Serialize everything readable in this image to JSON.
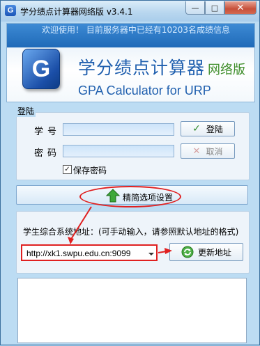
{
  "window": {
    "title": "学分绩点计算器网络版 v3.4.1",
    "app_icon_letter": "G",
    "minimize_symbol": "—",
    "maximize_symbol": "□",
    "close_symbol": "✕"
  },
  "banner": {
    "marquee": "欢迎使用！ 目前服务器中已经有10203名成绩信息",
    "logo_letter": "G",
    "title_cn": "学分绩点计算器",
    "title_suffix": "网络版",
    "title_en": "GPA Calculator for URP"
  },
  "login": {
    "group_label": "登陆",
    "student_id_label": "学号",
    "password_label": "密码",
    "student_id_value": "",
    "password_value": "",
    "login_button": "登陆",
    "cancel_button": "取消",
    "remember_label": "保存密码",
    "remember_checked": true,
    "check_mark": "✓"
  },
  "settings": {
    "toggle_label": "精简选项设置"
  },
  "address": {
    "label": "学生综合系统地址：(可手动输入，请参照默认地址的格式)",
    "value": "http://xk1.swpu.edu.cn:9099",
    "update_button": "更新地址"
  },
  "colors": {
    "highlight": "#e02020",
    "brand_blue": "#1f5fae",
    "brand_green": "#3f8e2c"
  }
}
